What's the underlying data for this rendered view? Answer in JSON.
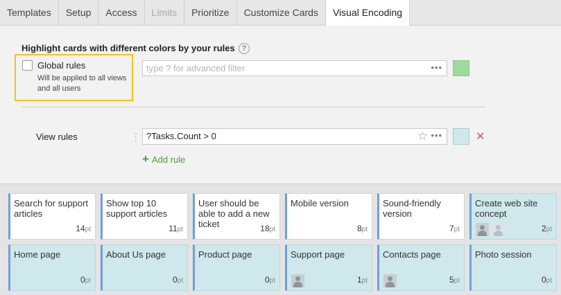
{
  "tabs": [
    {
      "label": "Templates"
    },
    {
      "label": "Setup"
    },
    {
      "label": "Access"
    },
    {
      "label": "Limits"
    },
    {
      "label": "Prioritize"
    },
    {
      "label": "Customize Cards"
    },
    {
      "label": "Visual Encoding"
    }
  ],
  "active_tab": "Visual Encoding",
  "settings": {
    "heading": "Highlight cards with different colors by your rules",
    "help_icon": "?",
    "global_rules": {
      "checked": false,
      "label": "Global rules",
      "description": "Will be applied to all views and all users",
      "filter_placeholder": "type ? for advanced filter",
      "color": "#9bdb9e"
    },
    "view_rules": {
      "label": "View rules",
      "rules": [
        {
          "filter": "?Tasks.Count > 0",
          "color": "#cfe8ec"
        }
      ],
      "add_rule_label": "Add rule"
    },
    "more_icon": "•••",
    "star_icon": "☆",
    "remove_icon": "✕"
  },
  "cards": [
    {
      "title": "Search for support articles",
      "points": "14",
      "unit": "pt",
      "highlighted": false,
      "avatars": 0
    },
    {
      "title": "Show top 10 support articles",
      "points": "11",
      "unit": "pt",
      "highlighted": false,
      "avatars": 0
    },
    {
      "title": "User should be able to add a new ticket",
      "points": "18",
      "unit": "pt",
      "highlighted": false,
      "avatars": 0
    },
    {
      "title": "Mobile version",
      "points": "8",
      "unit": "pt",
      "highlighted": false,
      "avatars": 0
    },
    {
      "title": "Sound-friendly version",
      "points": "7",
      "unit": "pt",
      "highlighted": false,
      "avatars": 0
    },
    {
      "title": "Create web site concept",
      "points": "2",
      "unit": "pt",
      "highlighted": true,
      "avatars": 2
    },
    {
      "title": "Home page",
      "points": "0",
      "unit": "pt",
      "highlighted": true,
      "avatars": 0
    },
    {
      "title": "About Us page",
      "points": "0",
      "unit": "pt",
      "highlighted": true,
      "avatars": 0
    },
    {
      "title": "Product page",
      "points": "0",
      "unit": "pt",
      "highlighted": true,
      "avatars": 0
    },
    {
      "title": "Support page",
      "points": "1",
      "unit": "pt",
      "highlighted": true,
      "avatars": 1
    },
    {
      "title": "Contacts page",
      "points": "5",
      "unit": "pt",
      "highlighted": true,
      "avatars": 1
    },
    {
      "title": "Photo session",
      "points": "0",
      "unit": "pt",
      "highlighted": true,
      "avatars": 0
    }
  ]
}
